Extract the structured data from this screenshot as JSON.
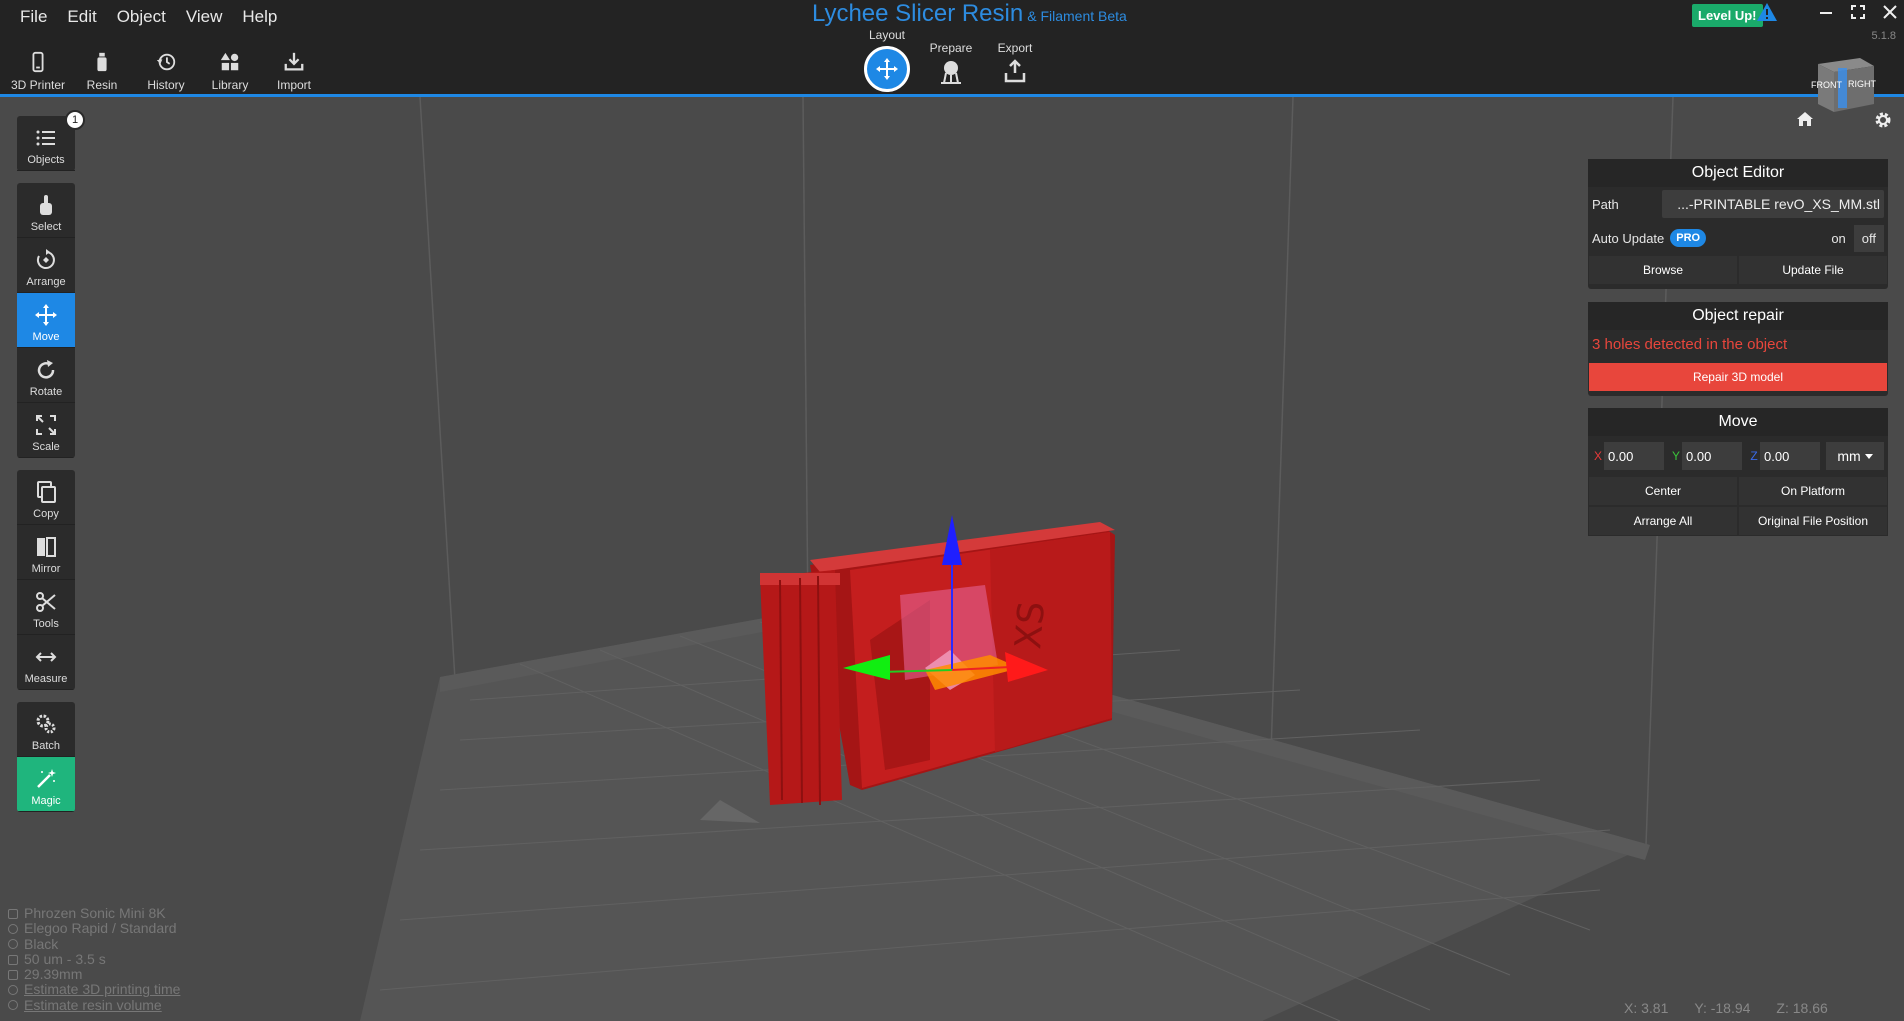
{
  "app": {
    "title": "Lychee Slicer Resin",
    "subtitle": "& Filament Beta",
    "version": "5.1.8",
    "level_up": "Level Up!"
  },
  "menu": [
    "File",
    "Edit",
    "Object",
    "View",
    "Help"
  ],
  "top_tools": [
    {
      "label": "3D Printer",
      "icon": "phone-printer-icon"
    },
    {
      "label": "Resin",
      "icon": "resin-bottle-icon"
    },
    {
      "label": "History",
      "icon": "history-icon"
    },
    {
      "label": "Library",
      "icon": "library-shapes-icon"
    },
    {
      "label": "Import",
      "icon": "import-icon"
    }
  ],
  "steps": [
    {
      "label": "Layout",
      "icon": "move-arrows-icon",
      "active": true
    },
    {
      "label": "Prepare",
      "icon": "supports-icon",
      "active": false
    },
    {
      "label": "Export",
      "icon": "export-icon",
      "active": false
    }
  ],
  "viewcube": {
    "front": "FRONT",
    "right": "RIGHT"
  },
  "left_tools": {
    "objects": {
      "label": "Objects",
      "badge": "1"
    },
    "select": "Select",
    "arrange": "Arrange",
    "move": "Move",
    "rotate": "Rotate",
    "scale": "Scale",
    "copy": "Copy",
    "mirror": "Mirror",
    "tools": "Tools",
    "measure": "Measure",
    "batch": "Batch",
    "magic": "Magic"
  },
  "object_editor": {
    "title": "Object Editor",
    "path_label": "Path",
    "path_value": "...-PRINTABLE revO_XS_MM.stl",
    "auto_update_label": "Auto Update",
    "pro": "PRO",
    "on": "on",
    "off": "off",
    "browse": "Browse",
    "update_file": "Update File"
  },
  "object_repair": {
    "title": "Object repair",
    "message": "3 holes detected in the object",
    "button": "Repair 3D model"
  },
  "move_panel": {
    "title": "Move",
    "x_label": "X",
    "x_value": "0.00",
    "y_label": "Y",
    "y_value": "0.00",
    "z_label": "Z",
    "z_value": "0.00",
    "unit": "mm",
    "center": "Center",
    "on_platform": "On Platform",
    "arrange_all": "Arrange All",
    "original_position": "Original File Position"
  },
  "info": {
    "printer": "Phrozen Sonic Mini 8K",
    "resin": "Elegoo Rapid / Standard",
    "color": "Black",
    "layer": "50 um - 3.5 s",
    "height": "29.39mm",
    "estimate_time": "Estimate 3D printing time",
    "estimate_volume": "Estimate resin volume"
  },
  "cursor": {
    "x": "X: 3.81",
    "y": "Y: -18.94",
    "z": "Z: 18.66"
  },
  "colors": {
    "accent": "#1e88e5",
    "model": "#c41e1e",
    "repair": "#e8463c",
    "magic": "#1fb57d"
  }
}
